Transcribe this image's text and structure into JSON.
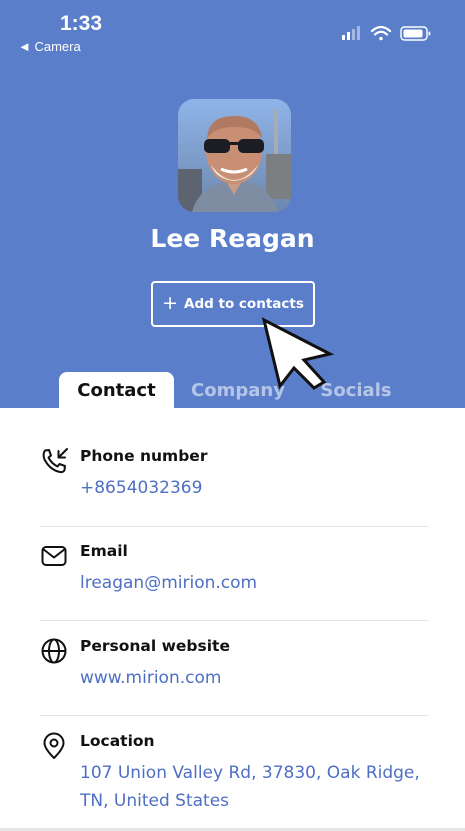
{
  "status_bar": {
    "time": "1:33",
    "back_label": "◄ Camera"
  },
  "profile": {
    "name": "Lee Reagan"
  },
  "actions": {
    "add_contact_icon": "+",
    "add_contact_label": "Add to contacts"
  },
  "tabs": [
    {
      "label": "Contact",
      "active": true
    },
    {
      "label": "Company",
      "active": false
    },
    {
      "label": "Socials",
      "active": false
    }
  ],
  "fields": [
    {
      "icon": "phone-incoming-icon",
      "label": "Phone number",
      "value": "+8654032369"
    },
    {
      "icon": "mail-icon",
      "label": "Email",
      "value": "lreagan@mirion.com"
    },
    {
      "icon": "globe-icon",
      "label": "Personal website",
      "value": "www.mirion.com"
    },
    {
      "icon": "location-pin-icon",
      "label": "Location",
      "value": "107 Union Valley Rd, 37830, Oak Ridge, TN, United States"
    }
  ],
  "colors": {
    "header": "#5b7ecb",
    "link": "#4f6fc4",
    "label": "#111111"
  }
}
